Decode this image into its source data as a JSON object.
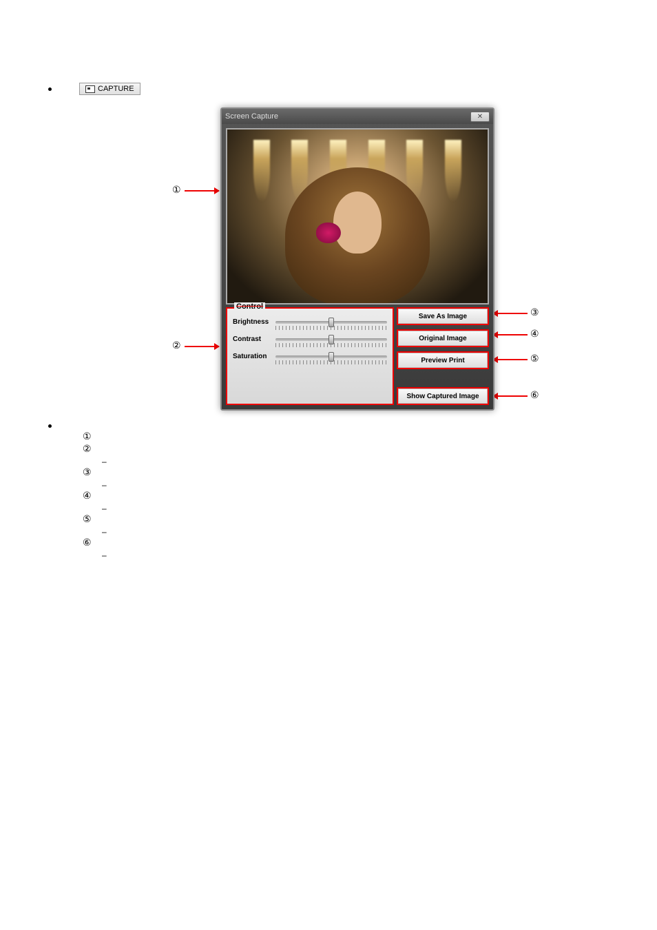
{
  "button": {
    "label": "CAPTURE"
  },
  "dialog": {
    "title": "Screen Capture",
    "close": "✕",
    "control_legend": "Control",
    "sliders": {
      "brightness": "Brightness",
      "contrast": "Contrast",
      "saturation": "Saturation"
    },
    "buttons": {
      "save": "Save As Image",
      "original": "Original Image",
      "preview": "Preview Print",
      "show": "Show Captured Image"
    }
  },
  "callouts": {
    "c1": "①",
    "c2": "②",
    "c3": "③",
    "c4": "④",
    "c5": "⑤",
    "c6": "⑥"
  },
  "desc": {
    "n1": "①",
    "n2": "②",
    "n3": "③",
    "n4": "④",
    "n5": "⑤",
    "n6": "⑥",
    "dash": "–"
  }
}
